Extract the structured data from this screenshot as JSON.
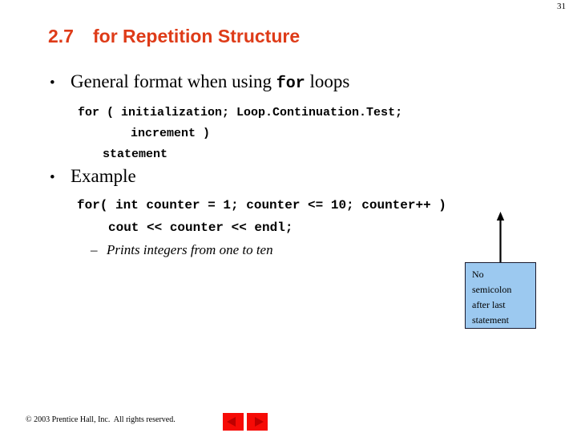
{
  "page_number": "31",
  "title": {
    "number": "2.7",
    "text": "for Repetition Structure",
    "color": "#DE3B18"
  },
  "bullets": [
    {
      "marker": "•",
      "text_before": "General format when using ",
      "text_mono": "for",
      "text_after": " loops"
    },
    {
      "marker": "•",
      "text_before": "Example",
      "text_mono": "",
      "text_after": ""
    }
  ],
  "code_general": {
    "line1": "for ( initialization; Loop.Continuation.Test;",
    "line2": "increment )",
    "line3": "statement"
  },
  "code_example": {
    "line1": "for( int counter = 1; counter <= 10; counter++ )",
    "line2": "cout << counter << endl;"
  },
  "sub_bullet": {
    "marker": "–",
    "text": "Prints integers from one to ten"
  },
  "callout": {
    "lines": "No\nsemicolon\nafter last\nstatement",
    "fill_color": "#9CC9F0",
    "border_color": "#1A1A2E"
  },
  "footer": {
    "copyright": "© 2003 Prentice Hall, Inc.  All rights reserved.",
    "prev_label": "Previous slide",
    "next_label": "Next slide",
    "button_color": "#F60B06"
  }
}
